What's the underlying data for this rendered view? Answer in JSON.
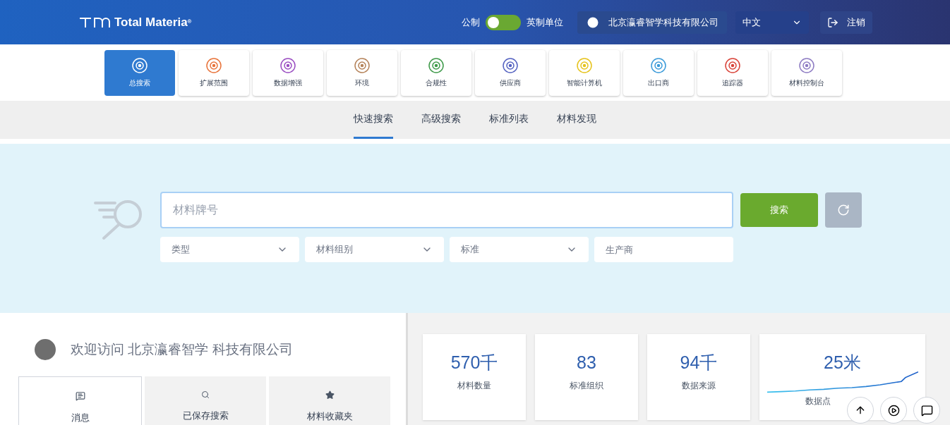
{
  "header": {
    "brand": "Total Materia",
    "brand_mark": "®",
    "unit_left": "公制",
    "unit_right": "英制单位",
    "imperial": false,
    "company": "北京瀛睿智学科技有限公司",
    "language": "中文",
    "logout": "注销"
  },
  "modules": [
    {
      "label": "总搜索",
      "selected": true,
      "color": "#ffffff"
    },
    {
      "label": "扩展范围",
      "selected": false,
      "color": "#e8743b"
    },
    {
      "label": "数据增强",
      "selected": false,
      "color": "#9b4fc2"
    },
    {
      "label": "环境",
      "selected": false,
      "color": "#b5835a"
    },
    {
      "label": "合规性",
      "selected": false,
      "color": "#3f9a4a"
    },
    {
      "label": "供应商",
      "selected": false,
      "color": "#5563c1"
    },
    {
      "label": "智能计算机",
      "selected": false,
      "color": "#e6c31c"
    },
    {
      "label": "出口商",
      "selected": false,
      "color": "#3a9ad9"
    },
    {
      "label": "追踪器",
      "selected": false,
      "color": "#d9443a"
    },
    {
      "label": "材料控制台",
      "selected": false,
      "color": "#8e7cc3"
    }
  ],
  "search_tabs": [
    {
      "label": "快速搜索",
      "selected": true
    },
    {
      "label": "高级搜索",
      "selected": false
    },
    {
      "label": "标准列表",
      "selected": false
    },
    {
      "label": "材料发现",
      "selected": false
    }
  ],
  "search": {
    "placeholder": "材料牌号",
    "button": "搜索",
    "filters": [
      {
        "placeholder": "类型",
        "kind": "dropdown"
      },
      {
        "placeholder": "材料组别",
        "kind": "dropdown"
      },
      {
        "placeholder": "标准",
        "kind": "dropdown"
      },
      {
        "placeholder": "生产商",
        "kind": "text"
      }
    ]
  },
  "welcome": {
    "text": "欢迎访问 北京瀛睿智学 科技有限公司",
    "tabs": [
      {
        "label": "消息",
        "kind": "message",
        "selected": true
      },
      {
        "label": "已保存搜索",
        "kind": "search",
        "selected": false
      },
      {
        "label": "材料收藏夹",
        "kind": "star",
        "selected": false
      }
    ]
  },
  "stats": [
    {
      "value": "570千",
      "label": "材料数量",
      "kind": "plain"
    },
    {
      "value": "83",
      "label": "标准组织",
      "kind": "plain"
    },
    {
      "value": "94千",
      "label": "数据来源",
      "kind": "plain"
    },
    {
      "value": "25米",
      "label": "数据点",
      "kind": "sparkline"
    }
  ]
}
